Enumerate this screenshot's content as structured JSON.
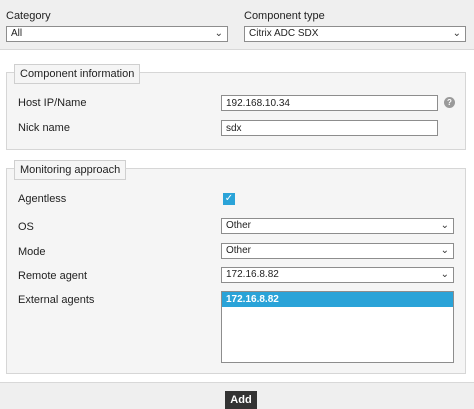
{
  "header": {
    "category_label": "Category",
    "category_value": "All",
    "component_type_label": "Component type",
    "component_type_value": "Citrix ADC SDX"
  },
  "component_information": {
    "legend": "Component information",
    "host_label": "Host IP/Name",
    "host_value": "192.168.10.34",
    "nick_label": "Nick name",
    "nick_value": "sdx",
    "help_glyph": "?"
  },
  "monitoring": {
    "legend": "Monitoring approach",
    "agentless_label": "Agentless",
    "agentless_checked": true,
    "check_glyph": "✓",
    "os_label": "OS",
    "os_value": "Other",
    "mode_label": "Mode",
    "mode_value": "Other",
    "remote_agent_label": "Remote agent",
    "remote_agent_value": "172.16.8.82",
    "external_agents_label": "External agents",
    "external_agents": [
      "172.16.8.82"
    ]
  },
  "footer": {
    "add_label": "Add"
  },
  "icons": {
    "chevron": "⌄"
  },
  "colors": {
    "accent": "#2aa3d8",
    "button": "#333333"
  }
}
